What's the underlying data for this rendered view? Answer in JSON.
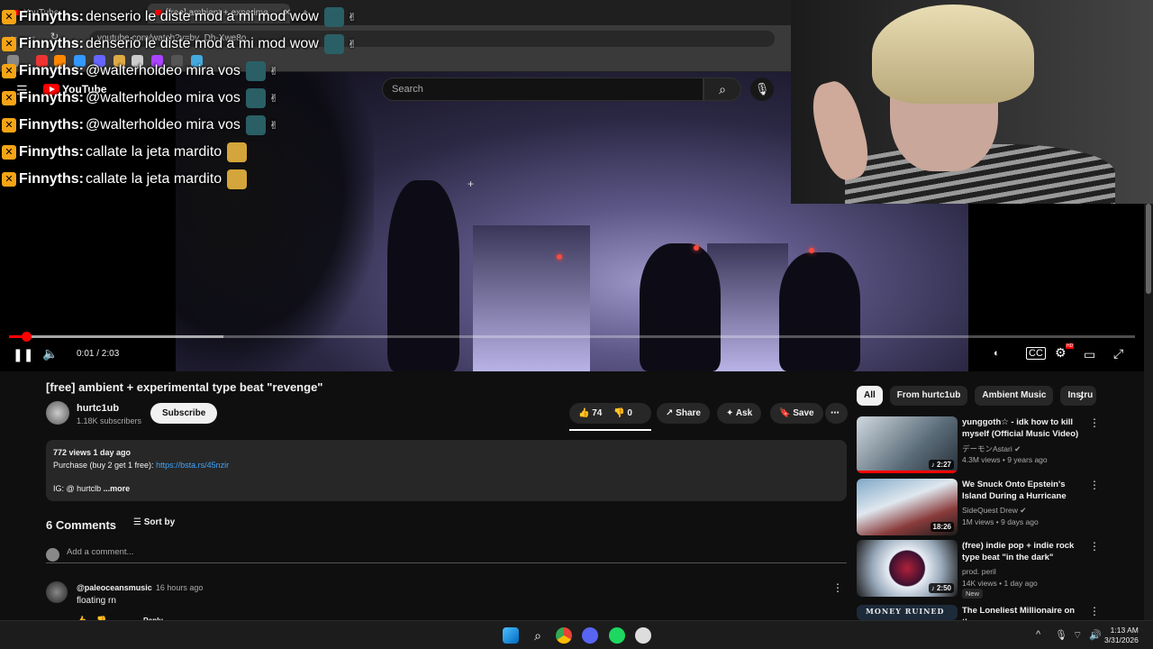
{
  "browser": {
    "tabs": [
      {
        "label": "YouTube"
      },
      {
        "label": "[free] ambient + experime..."
      }
    ],
    "url": "youtube.com/watch?v=bv_Dh-Xwe8o"
  },
  "chat": {
    "lines": [
      {
        "user": "Finnyths:",
        "message": "denserio le diste mod a mi mod wow"
      },
      {
        "user": "Finnyths:",
        "message": "denserio le diste mod a mi mod wow"
      },
      {
        "user": "Finnyths:",
        "message": "@walterholdeo mira vos"
      },
      {
        "user": "Finnyths:",
        "message": "@walterholdeo mira vos"
      },
      {
        "user": "Finnyths:",
        "message": "@walterholdeo mira vos"
      },
      {
        "user": "Finnyths:",
        "message": "callate la jeta mardito"
      },
      {
        "user": "Finnyths:",
        "message": "callate la jeta mardito"
      }
    ]
  },
  "youtube": {
    "logo": "YouTube",
    "search_placeholder": "Search"
  },
  "player": {
    "time": "0:01 / 2:03",
    "progress": 0.015,
    "buffered": 0.19,
    "hd_badge": "HD"
  },
  "video": {
    "title": "[free] ambient + experimental type beat \"revenge\"",
    "channel": "hurtc1ub",
    "subscribers": "1.18K subscribers",
    "subscribe_label": "Subscribe",
    "likes": "74",
    "dislikes": "0",
    "share_label": "Share",
    "ask_label": "Ask",
    "save_label": "Save",
    "description": {
      "views": "772 views  1 day ago",
      "line1": "Purchase (buy 2 get 1 free): ",
      "link": "https://bsta.rs/45nzir",
      "line3": "IG: @ hurtclb",
      "more": "...more"
    }
  },
  "comments": {
    "count": "6 Comments",
    "sort_label": "Sort by",
    "add_placeholder": "Add a comment...",
    "items": [
      {
        "author": "@paleoceansmusic",
        "time": "16 hours ago",
        "text": "floating rn",
        "reply": "Reply"
      }
    ]
  },
  "sidebar": {
    "chips": [
      "All",
      "From hurtc1ub",
      "Ambient Music",
      "Instru"
    ],
    "recommendations": [
      {
        "title": "yunggoth☆ - idk how to kill myself (Official Music Video)",
        "channel": "デーモンAstari",
        "meta": "4.3M views • 9 years ago",
        "duration": "2:27"
      },
      {
        "title": "We Snuck Onto Epstein's Island During a Hurricane",
        "channel": "SideQuest Drew",
        "meta": "1M views • 9 days ago",
        "duration": "18:26"
      },
      {
        "title": "(free) indie pop + indie rock type beat \"in the dark\"",
        "channel": "prod. peril",
        "meta": "14K views • 1 day ago",
        "duration": "2:50",
        "badge": "New"
      },
      {
        "title": "The Loneliest Millionaire on the",
        "channel": "",
        "meta": "",
        "duration": "",
        "thumb_text": "MONEY RUINED"
      }
    ]
  },
  "taskbar": {
    "time": "1:13 AM",
    "date": "3/31/2026"
  },
  "colors": {
    "accent": "#ff0000",
    "link": "#3ea6ff",
    "background": "#0f0f0f"
  }
}
